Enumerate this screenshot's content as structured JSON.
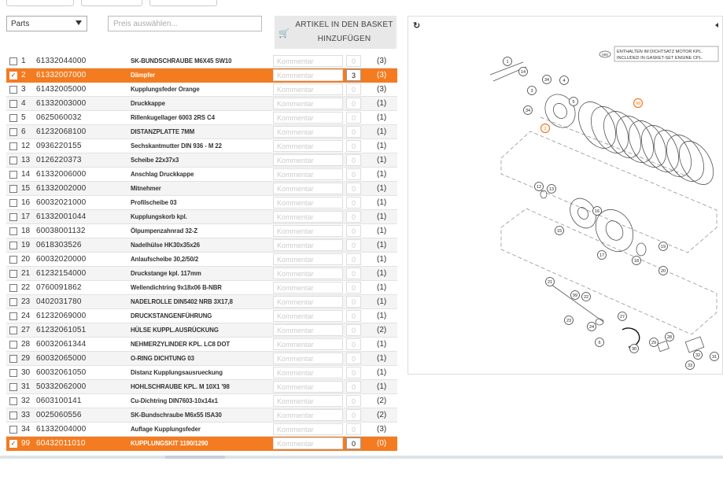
{
  "filter": {
    "category_value": "Parts",
    "price_placeholder": "Preis auswählen..."
  },
  "basket_button": {
    "line1": "ARTIKEL IN DEN BASKET",
    "line2": "HINZUFÜGEN"
  },
  "colors": {
    "accent": "#f47b20",
    "row_alt": "#f4f4f4"
  },
  "icons": {
    "basket": "shopping-cart-icon",
    "refresh": "refresh-icon",
    "collapse": "caret-left-icon"
  },
  "comment_placeholder": "Kommentar",
  "parts": [
    {
      "pos": "1",
      "num": "61332044000",
      "desc": "SK-BUNDSCHRAUBE M6X45 SW10",
      "qty": "0",
      "count": "(3)",
      "checked": false
    },
    {
      "pos": "2",
      "num": "61332007000",
      "desc": "Dämpfer",
      "qty": "3",
      "count": "(3)",
      "checked": true
    },
    {
      "pos": "3",
      "num": "61432005000",
      "desc": "Kupplungsfeder Orange",
      "qty": "0",
      "count": "(3)",
      "checked": false
    },
    {
      "pos": "4",
      "num": "61332003000",
      "desc": "Druckkappe",
      "qty": "0",
      "count": "(1)",
      "checked": false
    },
    {
      "pos": "5",
      "num": "0625060032",
      "desc": "Rillenkugellager 6003 2RS C4",
      "qty": "0",
      "count": "(1)",
      "checked": false
    },
    {
      "pos": "6",
      "num": "61232068100",
      "desc": "DISTANZPLATTE 7MM",
      "qty": "0",
      "count": "(1)",
      "checked": false
    },
    {
      "pos": "12",
      "num": "0936220155",
      "desc": "Sechskantmutter DIN 936 - M 22",
      "qty": "0",
      "count": "(1)",
      "checked": false
    },
    {
      "pos": "13",
      "num": "0126220373",
      "desc": "Scheibe 22x37x3",
      "qty": "0",
      "count": "(1)",
      "checked": false
    },
    {
      "pos": "14",
      "num": "61332006000",
      "desc": "Anschlag Druckkappe",
      "qty": "0",
      "count": "(1)",
      "checked": false
    },
    {
      "pos": "15",
      "num": "61332002000",
      "desc": "Mitnehmer",
      "qty": "0",
      "count": "(1)",
      "checked": false
    },
    {
      "pos": "16",
      "num": "60032021000",
      "desc": "Profilscheibe 03",
      "qty": "0",
      "count": "(1)",
      "checked": false
    },
    {
      "pos": "17",
      "num": "61332001044",
      "desc": "Kupplungskorb kpl.",
      "qty": "0",
      "count": "(1)",
      "checked": false
    },
    {
      "pos": "18",
      "num": "60038001132",
      "desc": "Ölpumpenzahnrad 32-Z",
      "qty": "0",
      "count": "(1)",
      "checked": false
    },
    {
      "pos": "19",
      "num": "0618303526",
      "desc": "Nadelhülse HK30x35x26",
      "qty": "0",
      "count": "(1)",
      "checked": false
    },
    {
      "pos": "20",
      "num": "60032020000",
      "desc": "Anlaufscheibe 30,2/50/2",
      "qty": "0",
      "count": "(1)",
      "checked": false
    },
    {
      "pos": "21",
      "num": "61232154000",
      "desc": "Druckstange kpl. 117mm",
      "qty": "0",
      "count": "(1)",
      "checked": false
    },
    {
      "pos": "22",
      "num": "0760091862",
      "desc": "Wellendichtring 9x18x06 B-NBR",
      "qty": "0",
      "count": "(1)",
      "checked": false
    },
    {
      "pos": "23",
      "num": "0402031780",
      "desc": "NADELROLLE DIN5402 NRB 3X17,8",
      "qty": "0",
      "count": "(1)",
      "checked": false
    },
    {
      "pos": "24",
      "num": "61232069000",
      "desc": "DRUCKSTANGENFÜHRUNG",
      "qty": "0",
      "count": "(1)",
      "checked": false
    },
    {
      "pos": "27",
      "num": "61232061051",
      "desc": "HÜLSE KUPPL.AUSRÜCKUNG",
      "qty": "0",
      "count": "(2)",
      "checked": false
    },
    {
      "pos": "28",
      "num": "60032061344",
      "desc": "NEHMERZYLINDER KPL. LC8 DOT",
      "qty": "0",
      "count": "(1)",
      "checked": false
    },
    {
      "pos": "29",
      "num": "60032065000",
      "desc": "O-RING DICHTUNG 03",
      "qty": "0",
      "count": "(1)",
      "checked": false
    },
    {
      "pos": "30",
      "num": "60032061050",
      "desc": "Distanz Kupplungsausrueckung",
      "qty": "0",
      "count": "(1)",
      "checked": false
    },
    {
      "pos": "31",
      "num": "50332062000",
      "desc": "HOHLSCHRAUBE KPL. M 10X1 '98",
      "qty": "0",
      "count": "(1)",
      "checked": false
    },
    {
      "pos": "32",
      "num": "0603100141",
      "desc": "Cu-Dichtring DIN7603-10x14x1",
      "qty": "0",
      "count": "(2)",
      "checked": false
    },
    {
      "pos": "33",
      "num": "0025060556",
      "desc": "SK-Bundschraube M6x55 ISA30",
      "qty": "0",
      "count": "(2)",
      "checked": false
    },
    {
      "pos": "34",
      "num": "61332004000",
      "desc": "Auflage Kupplungsfeder",
      "qty": "0",
      "count": "(3)",
      "checked": false
    },
    {
      "pos": "99",
      "num": "60432011010",
      "desc": "KUPPLUNGSKIT 1190/1290",
      "qty": "0",
      "count": "(0)",
      "checked": true
    }
  ],
  "diagram": {
    "legend_marker": "(99)",
    "legend_line1": "ENTHALTEN IM DICHTSATZ MOTOR KPL.",
    "legend_line2": "INCLUDED IN GASKET-SET ENGINE CPL.",
    "callouts": [
      "1",
      "14",
      "34",
      "3",
      "4",
      "2",
      "5",
      "34",
      "99",
      "12",
      "13",
      "16",
      "15",
      "17",
      "18",
      "19",
      "20",
      "21",
      "99",
      "22",
      "23",
      "27",
      "24",
      "6",
      "28",
      "30",
      "29",
      "32",
      "31",
      "33"
    ]
  }
}
